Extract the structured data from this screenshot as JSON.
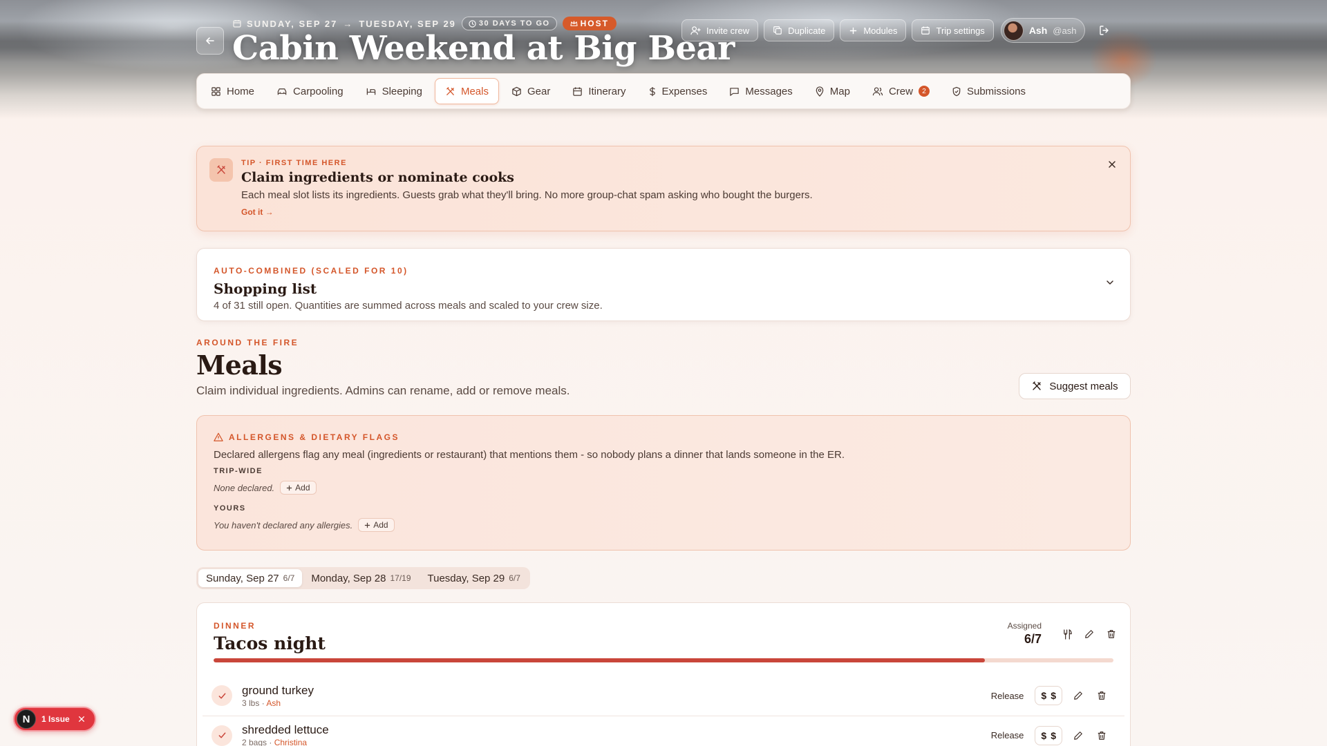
{
  "hero": {
    "start_date": "SUNDAY, SEP 27",
    "date_sep": "→",
    "end_date": "TUESDAY, SEP 29",
    "days_to_go": "30 DAYS TO GO",
    "role": "HOST",
    "title": "Cabin Weekend at Big Bear",
    "actions": {
      "invite": "Invite crew",
      "duplicate": "Duplicate",
      "modules": "Modules",
      "settings": "Trip settings"
    },
    "user": {
      "name": "Ash",
      "handle": "@ash"
    }
  },
  "tabs": {
    "home": "Home",
    "carpooling": "Carpooling",
    "sleeping": "Sleeping",
    "meals": "Meals",
    "gear": "Gear",
    "itinerary": "Itinerary",
    "expenses": "Expenses",
    "messages": "Messages",
    "map": "Map",
    "crew": "Crew",
    "crew_badge": "2",
    "submissions": "Submissions"
  },
  "tip": {
    "eyebrow": "TIP · FIRST TIME HERE",
    "title": "Claim ingredients or nominate cooks",
    "body": "Each meal slot lists its ingredients. Guests grab what they'll bring. No more group-chat spam asking who bought the burgers.",
    "link": "Got it →"
  },
  "shopping": {
    "eyebrow": "AUTO-COMBINED (SCALED FOR 10)",
    "title": "Shopping list",
    "sub": "4 of 31 still open. Quantities are summed across meals and scaled to your crew size."
  },
  "section": {
    "eyebrow": "AROUND THE FIRE",
    "title": "Meals",
    "sub": "Claim individual ingredients. Admins can rename, add or remove meals.",
    "suggest": "Suggest meals"
  },
  "allergens": {
    "title": "ALLERGENS & DIETARY FLAGS",
    "desc": "Declared allergens flag any meal (ingredients or restaurant) that mentions them - so nobody plans a dinner that lands someone in the ER.",
    "trip_label": "TRIP-WIDE",
    "trip_value": "None declared.",
    "yours_label": "YOURS",
    "yours_value": "You haven't declared any allergies.",
    "add": "Add"
  },
  "days": [
    {
      "label": "Sunday, Sep 27",
      "count": "6/7"
    },
    {
      "label": "Monday, Sep 28",
      "count": "17/19"
    },
    {
      "label": "Tuesday, Sep 29",
      "count": "6/7"
    }
  ],
  "meal": {
    "eyebrow": "DINNER",
    "title": "Tacos night",
    "assigned_label": "Assigned",
    "assigned_value": "6/7",
    "progress_fraction": 0.857,
    "progress_color": "#c9463a",
    "ingredients": [
      {
        "name": "ground turkey",
        "qty": "3 lbs",
        "who": "Ash",
        "action": "Release"
      },
      {
        "name": "shredded lettuce",
        "qty": "2 bags",
        "who": "Christina",
        "action": "Release"
      }
    ]
  },
  "issue": {
    "badge": "N",
    "label": "1 Issue"
  },
  "colors": {
    "accent": "#d4562a",
    "danger": "#e0363e"
  }
}
